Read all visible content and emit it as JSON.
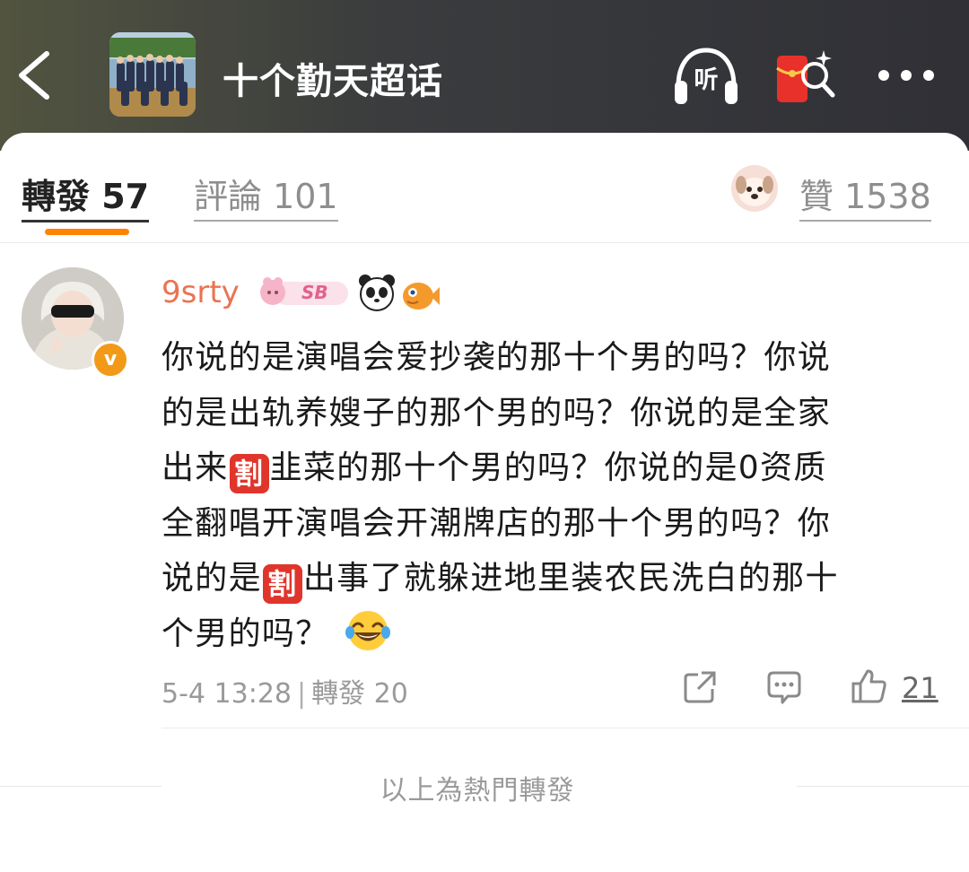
{
  "header": {
    "title": "十个勤天超话",
    "listen_label": "听"
  },
  "tabs": {
    "reposts": "轉發 57",
    "comments": "評論 101",
    "likes": "贊 1538"
  },
  "post": {
    "username": "9srty",
    "level_badge": "SB",
    "verified_mark": "v",
    "content_lines": [
      "你说的是演唱会爱抄袭的那十个男的吗？你说",
      "的是出轨养嫂子的那个男的吗？你说的是全家",
      [
        "出来",
        "割",
        "韭菜的那十个男的吗？你说的是0资质"
      ],
      "全翻唱开演唱会开潮牌店的那十个男的吗？你",
      [
        "说的是",
        "割",
        "出事了就躲进地里装农民洗白的那十"
      ],
      "个男的吗？"
    ],
    "sticker_label": "割",
    "time": "5-4 13:28",
    "repost_info": "轉發 20",
    "like_count": "21"
  },
  "footer": {
    "hot_label": "以上為熱門轉發"
  },
  "icons": {
    "back": "chevron-left-icon",
    "listen": "headphones-icon",
    "red_packet": "red-packet-search-icon",
    "more": "more-dots-icon",
    "share": "share-icon",
    "comment": "comment-icon",
    "like": "thumbs-up-icon",
    "laugh": "laughing-tears-emoji"
  },
  "colors": {
    "accent_orange": "#ff8200",
    "username": "#eb7350",
    "sticker_red": "#e0352b"
  }
}
